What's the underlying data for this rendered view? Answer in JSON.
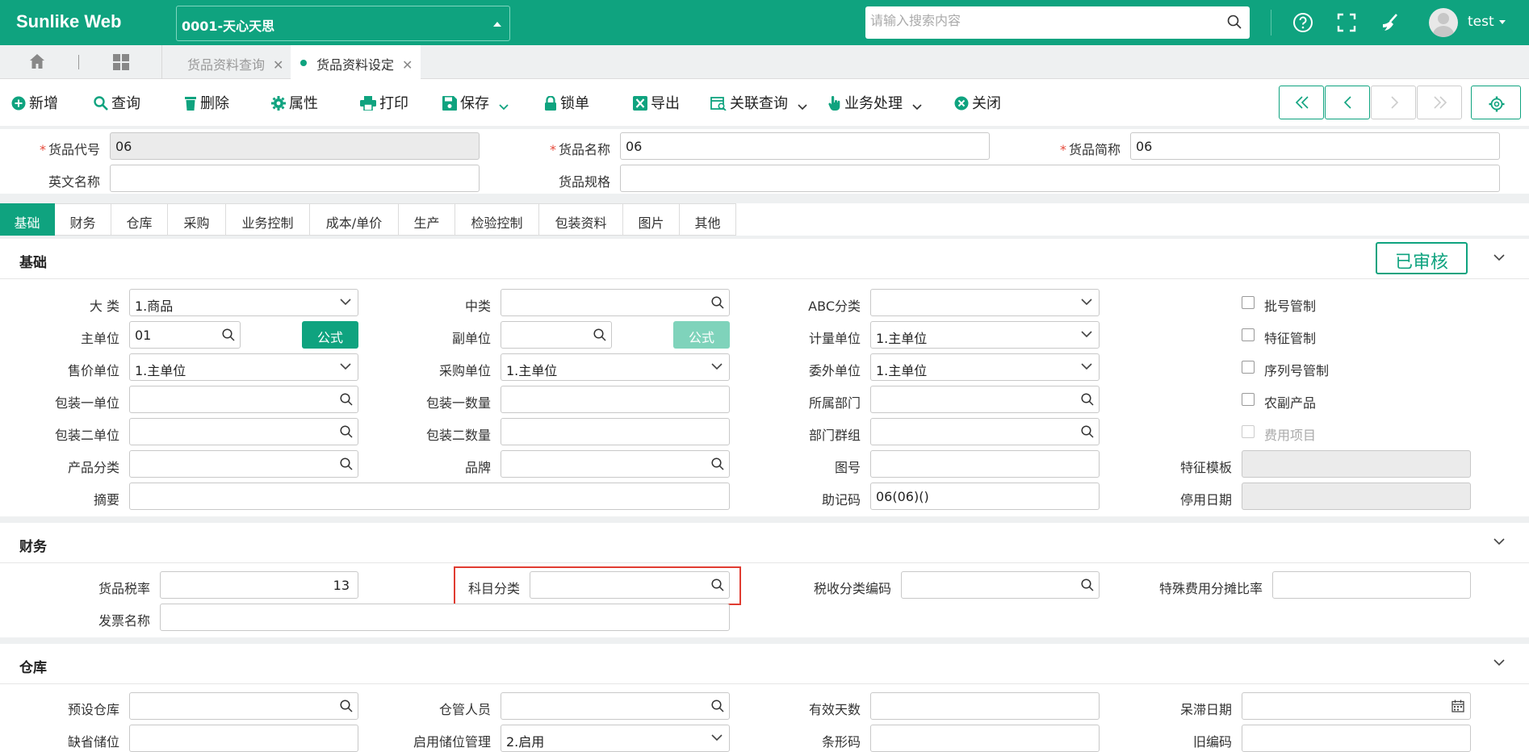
{
  "app": {
    "title": "Sunlike Web",
    "account": "0001-天心天思",
    "search_placeholder": "请输入搜索内容",
    "user": "test"
  },
  "tabs": [
    {
      "label": "货品资料查询",
      "active": false
    },
    {
      "label": "货品资料设定",
      "active": true
    }
  ],
  "toolbar": {
    "add": "新增",
    "query": "查询",
    "delete": "删除",
    "properties": "属性",
    "print": "打印",
    "save": "保存",
    "lock": "锁单",
    "export": "导出",
    "related_query": "关联查询",
    "business": "业务处理",
    "close": "关闭"
  },
  "header_form": {
    "code_label": "货品代号",
    "code_value": "06",
    "name_label": "货品名称",
    "name_value": "06",
    "short_label": "货品简称",
    "short_value": "06",
    "english_label": "英文名称",
    "english_value": "",
    "spec_label": "货品规格",
    "spec_value": ""
  },
  "section_tabs": [
    "基础",
    "财务",
    "仓库",
    "采购",
    "业务控制",
    "成本/单价",
    "生产",
    "检验控制",
    "包装资料",
    "图片",
    "其他"
  ],
  "basic": {
    "title": "基础",
    "status": "已审核",
    "major_label": "大 类",
    "major_value": "1.商品",
    "mid_label": "中类",
    "mid_value": "",
    "abc_label": "ABC分类",
    "abc_value": "",
    "main_unit_label": "主单位",
    "main_unit_value": "01",
    "formula": "公式",
    "sub_unit_label": "副单位",
    "sub_unit_value": "",
    "measure_unit_label": "计量单位",
    "measure_unit_value": "1.主单位",
    "sale_unit_label": "售价单位",
    "sale_unit_value": "1.主单位",
    "purchase_unit_label": "采购单位",
    "purchase_unit_value": "1.主单位",
    "outsource_unit_label": "委外单位",
    "outsource_unit_value": "1.主单位",
    "pack1_unit_label": "包装一单位",
    "pack1_qty_label": "包装一数量",
    "dept_label": "所属部门",
    "pack2_unit_label": "包装二单位",
    "pack2_qty_label": "包装二数量",
    "dept_group_label": "部门群组",
    "category_label": "产品分类",
    "brand_label": "品牌",
    "drawing_label": "图号",
    "summary_label": "摘要",
    "mnemonic_label": "助记码",
    "mnemonic_value": "06(06)()",
    "feature_template_label": "特征模板",
    "stop_date_label": "停用日期",
    "checkboxes": [
      {
        "label": "批号管制",
        "checked": false,
        "disabled": false
      },
      {
        "label": "特征管制",
        "checked": false,
        "disabled": false
      },
      {
        "label": "序列号管制",
        "checked": false,
        "disabled": false
      },
      {
        "label": "农副产品",
        "checked": false,
        "disabled": false
      },
      {
        "label": "费用项目",
        "checked": false,
        "disabled": true
      }
    ]
  },
  "finance": {
    "title": "财务",
    "tax_rate_label": "货品税率",
    "tax_rate_value": "13",
    "subject_label": "科目分类",
    "subject_value": "",
    "tax_code_label": "税收分类编码",
    "tax_code_value": "",
    "special_rate_label": "特殊费用分摊比率",
    "special_rate_value": "",
    "invoice_label": "发票名称",
    "invoice_value": ""
  },
  "warehouse": {
    "title": "仓库",
    "default_wh_label": "预设仓库",
    "keeper_label": "仓管人员",
    "valid_days_label": "有效天数",
    "stagnant_label": "呆滞日期",
    "default_loc_label": "缺省储位",
    "enable_loc_label": "启用储位管理",
    "enable_loc_value": "2.启用",
    "barcode_label": "条形码",
    "old_code_label": "旧编码"
  },
  "colors": {
    "brand": "#0fa37f",
    "required": "#e64a3b",
    "highlight": "#e03c31"
  }
}
